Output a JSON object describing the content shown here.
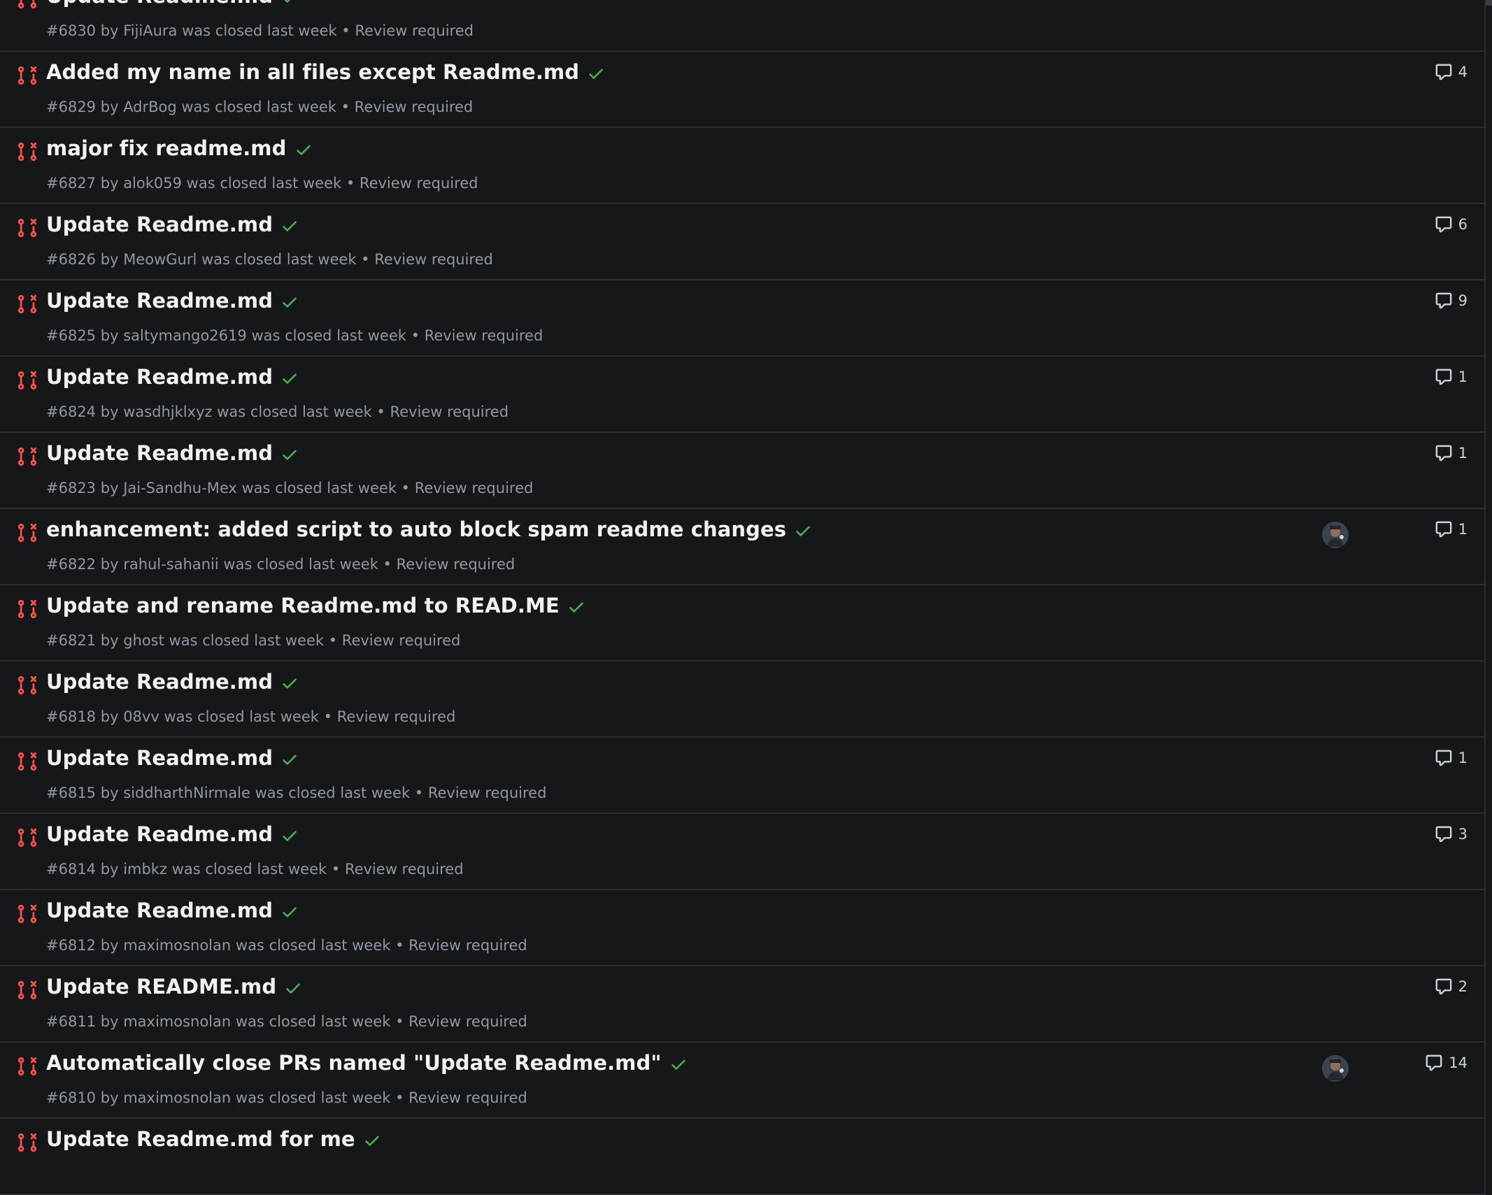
{
  "colors": {
    "background": "#161719",
    "closed_pr": "#f85149",
    "check": "#3fb950",
    "muted": "#9198a1"
  },
  "icons": {
    "pr_state": "git-pull-request-closed-icon",
    "status": "check-icon",
    "comments": "comment-icon"
  },
  "pull_requests": [
    {
      "title": "Update Readme.md",
      "number": "#6830",
      "by": "by",
      "author": "FijiAura",
      "state": "was closed last week",
      "sep": "•",
      "review": "Review required",
      "comments": "",
      "has_avatar": false
    },
    {
      "title": "Added my name in all files except Readme.md",
      "number": "#6829",
      "by": "by",
      "author": "AdrBog",
      "state": "was closed last week",
      "sep": "•",
      "review": "Review required",
      "comments": "4",
      "has_avatar": false
    },
    {
      "title": "major fix readme.md",
      "number": "#6827",
      "by": "by",
      "author": "alok059",
      "state": "was closed last week",
      "sep": "•",
      "review": "Review required",
      "comments": "",
      "has_avatar": false
    },
    {
      "title": "Update Readme.md",
      "number": "#6826",
      "by": "by",
      "author": "MeowGurl",
      "state": "was closed last week",
      "sep": "•",
      "review": "Review required",
      "comments": "6",
      "has_avatar": false
    },
    {
      "title": "Update Readme.md",
      "number": "#6825",
      "by": "by",
      "author": "saltymango2619",
      "state": "was closed last week",
      "sep": "•",
      "review": "Review required",
      "comments": "9",
      "has_avatar": false
    },
    {
      "title": "Update Readme.md",
      "number": "#6824",
      "by": "by",
      "author": "wasdhjklxyz",
      "state": "was closed last week",
      "sep": "•",
      "review": "Review required",
      "comments": "1",
      "has_avatar": false
    },
    {
      "title": "Update Readme.md",
      "number": "#6823",
      "by": "by",
      "author": "Jai-Sandhu-Mex",
      "state": "was closed last week",
      "sep": "•",
      "review": "Review required",
      "comments": "1",
      "has_avatar": false
    },
    {
      "title": "enhancement: added script to auto block spam readme changes",
      "number": "#6822",
      "by": "by",
      "author": "rahul-sahanii",
      "state": "was closed last week",
      "sep": "•",
      "review": "Review required",
      "comments": "1",
      "has_avatar": true
    },
    {
      "title": "Update and rename Readme.md to READ.ME",
      "number": "#6821",
      "by": "by",
      "author": "ghost",
      "state": "was closed last week",
      "sep": "•",
      "review": "Review required",
      "comments": "",
      "has_avatar": false
    },
    {
      "title": "Update Readme.md",
      "number": "#6818",
      "by": "by",
      "author": "08vv",
      "state": "was closed last week",
      "sep": "•",
      "review": "Review required",
      "comments": "",
      "has_avatar": false
    },
    {
      "title": "Update Readme.md",
      "number": "#6815",
      "by": "by",
      "author": "siddharthNirmale",
      "state": "was closed last week",
      "sep": "•",
      "review": "Review required",
      "comments": "1",
      "has_avatar": false
    },
    {
      "title": "Update Readme.md",
      "number": "#6814",
      "by": "by",
      "author": "imbkz",
      "state": "was closed last week",
      "sep": "•",
      "review": "Review required",
      "comments": "3",
      "has_avatar": false
    },
    {
      "title": "Update Readme.md",
      "number": "#6812",
      "by": "by",
      "author": "maximosnolan",
      "state": "was closed last week",
      "sep": "•",
      "review": "Review required",
      "comments": "",
      "has_avatar": false
    },
    {
      "title": "Update README.md",
      "number": "#6811",
      "by": "by",
      "author": "maximosnolan",
      "state": "was closed last week",
      "sep": "•",
      "review": "Review required",
      "comments": "2",
      "has_avatar": false
    },
    {
      "title": "Automatically close PRs named \"Update Readme.md\"",
      "number": "#6810",
      "by": "by",
      "author": "maximosnolan",
      "state": "was closed last week",
      "sep": "•",
      "review": "Review required",
      "comments": "14",
      "has_avatar": true
    },
    {
      "title": "Update Readme.md for me",
      "number": "",
      "by": "",
      "author": "",
      "state": "",
      "sep": "",
      "review": "",
      "comments": "",
      "has_avatar": false
    }
  ]
}
